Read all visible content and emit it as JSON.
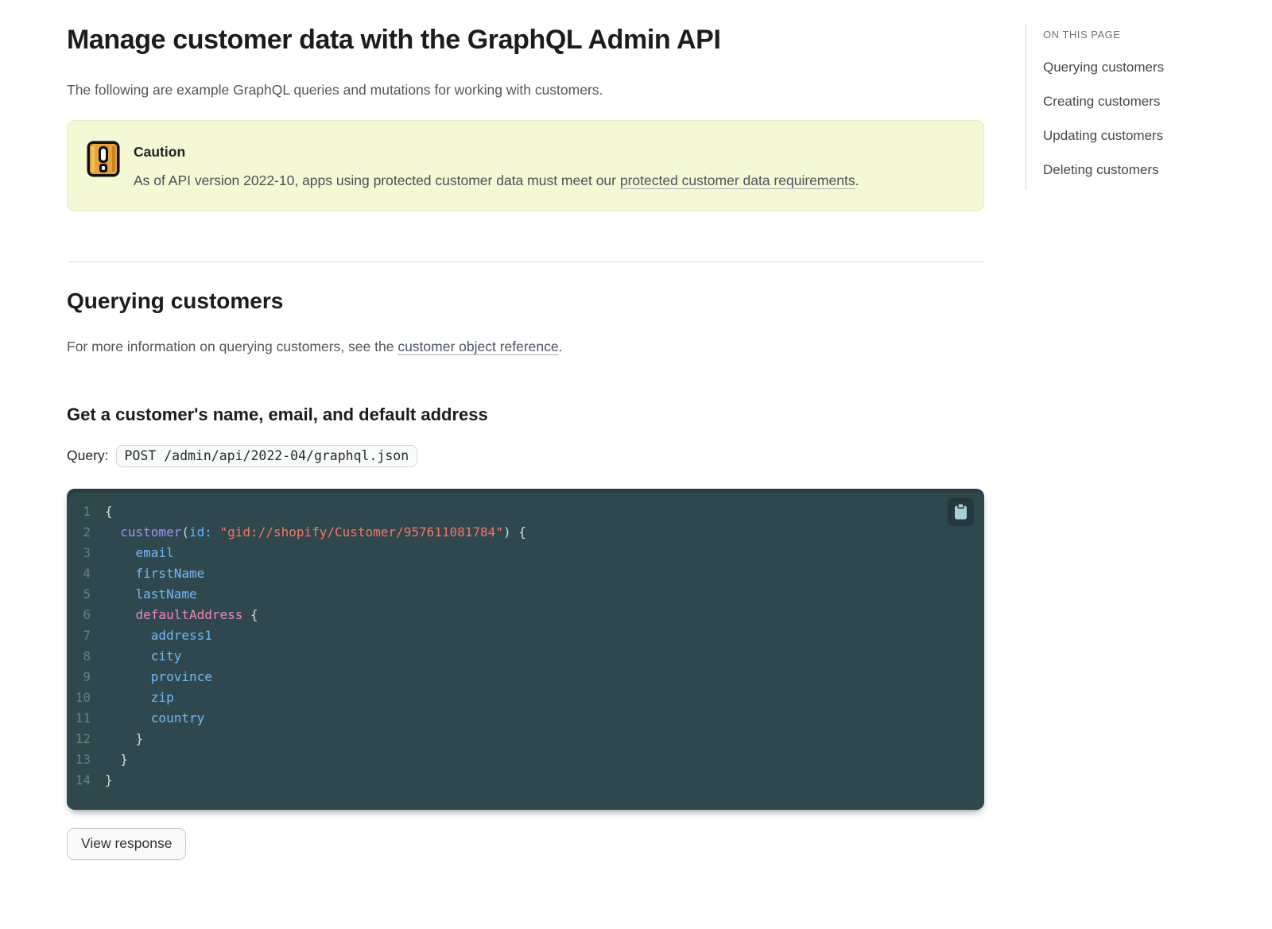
{
  "page": {
    "title": "Manage customer data with the GraphQL Admin API",
    "intro": "The following are example GraphQL queries and mutations for working with customers."
  },
  "caution": {
    "title": "Caution",
    "text_before_link": "As of API version 2022-10, apps using protected customer data must meet our ",
    "link_text": "protected customer data requirements",
    "text_after_link": ".",
    "icon": "pixel-exclamation-icon",
    "background_color": "#f4f8d5",
    "icon_color": "#e9a23b"
  },
  "querying_section": {
    "heading": "Querying customers",
    "para_before_link": "For more information on querying customers, see the ",
    "link_text": "customer object reference",
    "para_after_link": ".",
    "example_heading": "Get a customer's name, email, and default address",
    "query_label": "Query:",
    "endpoint": "POST /admin/api/2022-04/graphql.json"
  },
  "code_block": {
    "copy_icon": "clipboard-icon",
    "background_color": "#2f484e",
    "token_colors": {
      "punctuation": "#cfdcdc",
      "function": "#ab92f0",
      "argument": "#64b2fb",
      "string": "#f4766c",
      "field": "#74b9f7",
      "object_field": "#f087b8",
      "line_number": "#67827f"
    },
    "lines": [
      [
        {
          "t": "{",
          "c": "pun"
        }
      ],
      [
        {
          "t": "  "
        },
        {
          "t": "customer",
          "c": "fn"
        },
        {
          "t": "(",
          "c": "pun"
        },
        {
          "t": "id:",
          "c": "attr"
        },
        {
          "t": " "
        },
        {
          "t": "\"gid://shopify/Customer/957611081784\"",
          "c": "str"
        },
        {
          "t": ")",
          "c": "pun"
        },
        {
          "t": " {",
          "c": "pun"
        }
      ],
      [
        {
          "t": "    "
        },
        {
          "t": "email",
          "c": "field"
        }
      ],
      [
        {
          "t": "    "
        },
        {
          "t": "firstName",
          "c": "field"
        }
      ],
      [
        {
          "t": "    "
        },
        {
          "t": "lastName",
          "c": "field"
        }
      ],
      [
        {
          "t": "    "
        },
        {
          "t": "defaultAddress",
          "c": "obj"
        },
        {
          "t": " {",
          "c": "pun"
        }
      ],
      [
        {
          "t": "      "
        },
        {
          "t": "address1",
          "c": "field"
        }
      ],
      [
        {
          "t": "      "
        },
        {
          "t": "city",
          "c": "field"
        }
      ],
      [
        {
          "t": "      "
        },
        {
          "t": "province",
          "c": "field"
        }
      ],
      [
        {
          "t": "      "
        },
        {
          "t": "zip",
          "c": "field"
        }
      ],
      [
        {
          "t": "      "
        },
        {
          "t": "country",
          "c": "field"
        }
      ],
      [
        {
          "t": "    }",
          "c": "pun"
        }
      ],
      [
        {
          "t": "  }",
          "c": "pun"
        }
      ],
      [
        {
          "t": "}",
          "c": "pun"
        }
      ]
    ]
  },
  "buttons": {
    "view_response": "View response"
  },
  "toc": {
    "title": "ON THIS PAGE",
    "items": [
      "Querying customers",
      "Creating customers",
      "Updating customers",
      "Deleting customers"
    ]
  }
}
